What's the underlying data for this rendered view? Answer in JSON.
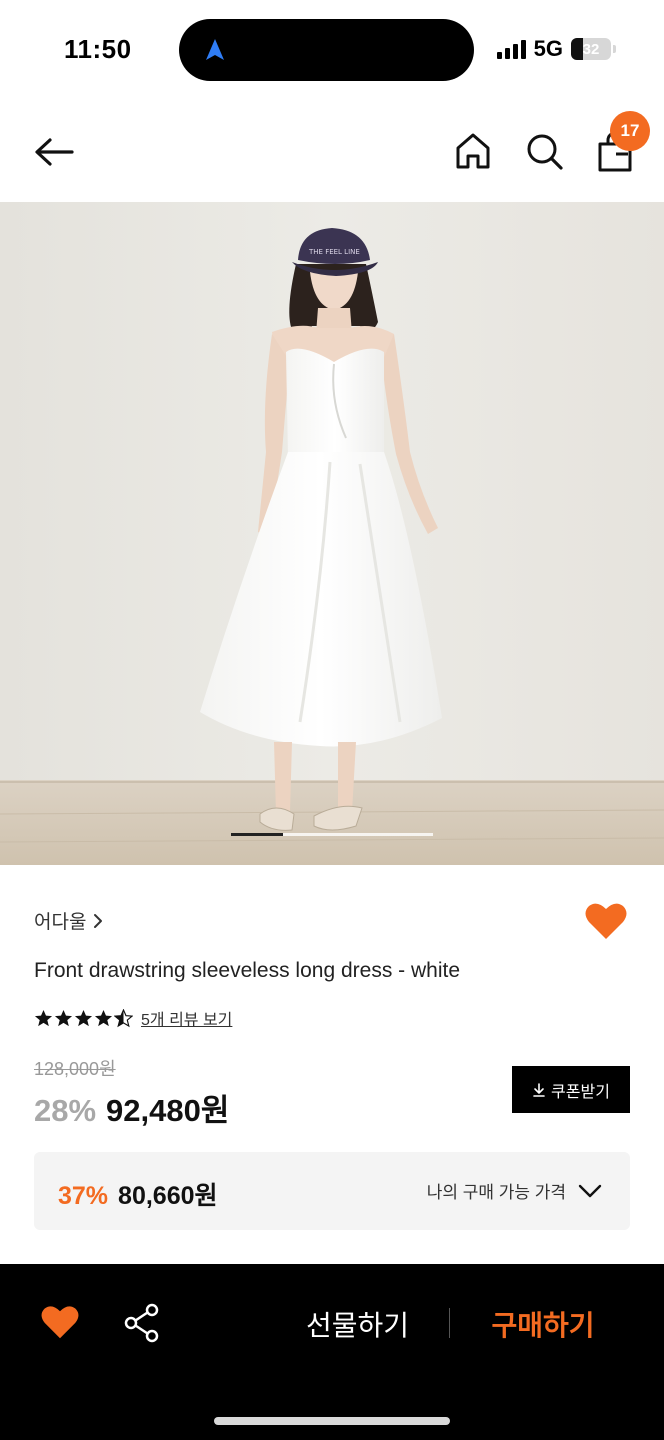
{
  "status_bar": {
    "time": "11:50",
    "network": "5G",
    "battery": "32"
  },
  "nav": {
    "cart_count": "17"
  },
  "product": {
    "brand": "어다울",
    "title": "Front drawstring sleeveless long dress - white",
    "rating": 4.5,
    "review_link": "5개 리뷰 보기",
    "original_price": "128,000원",
    "discount_percent": "28%",
    "sale_price": "92,480원",
    "coupon_button": "쿠폰받기",
    "my_price": {
      "discount_percent": "37%",
      "amount": "80,660원",
      "label": "나의 구매 가능 가격"
    },
    "image_carousel": {
      "current_index": 1,
      "total": 4
    }
  },
  "bottom_bar": {
    "gift_label": "선물하기",
    "buy_label": "구매하기"
  },
  "colors": {
    "accent": "#f36b21",
    "black": "#000000",
    "muted": "#a8a8a8"
  },
  "icons": [
    "back-arrow-icon",
    "home-icon",
    "search-icon",
    "shopping-bag-icon",
    "heart-icon",
    "share-icon",
    "star-icon",
    "chevron-right-icon",
    "chevron-down-icon",
    "download-icon",
    "navigation-arrow-icon"
  ]
}
